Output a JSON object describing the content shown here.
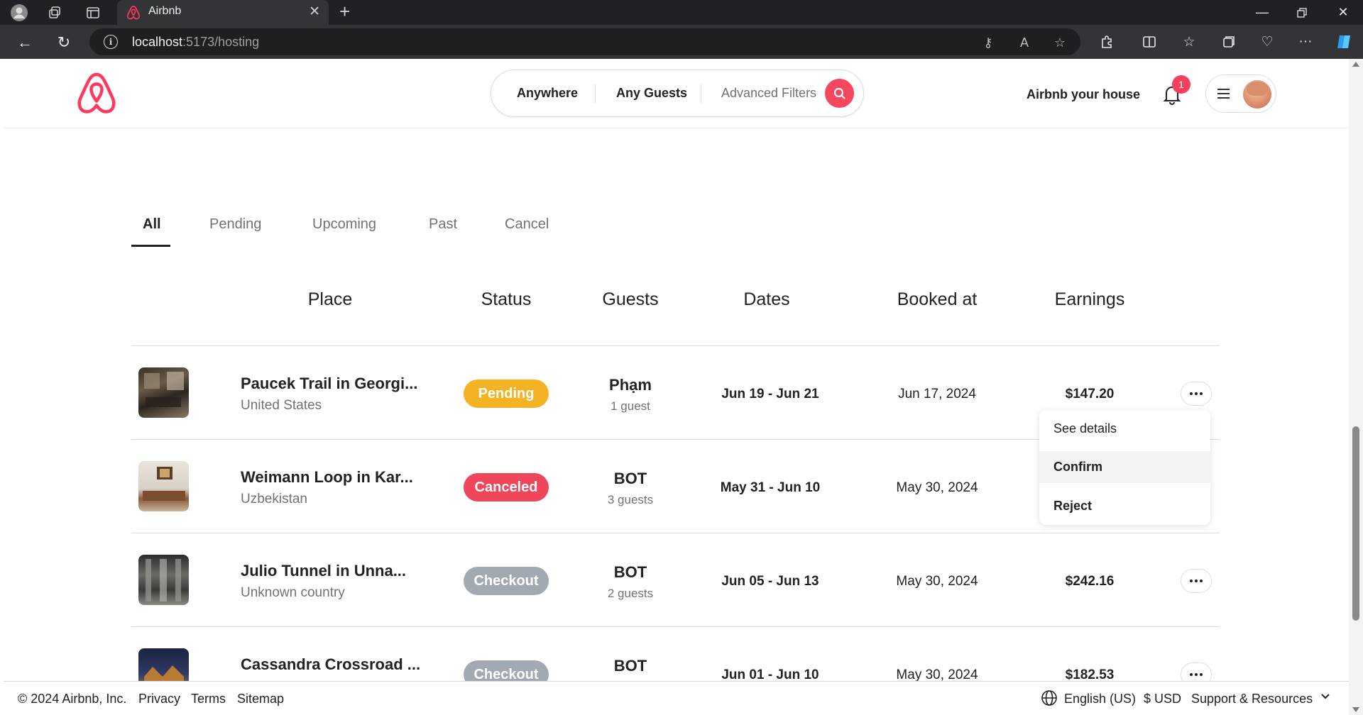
{
  "browser": {
    "tab_title": "Airbnb",
    "url_host": "localhost",
    "url_path": ":5173/hosting"
  },
  "header": {
    "search": {
      "anywhere": "Anywhere",
      "guests": "Any Guests",
      "filters": "Advanced Filters"
    },
    "host_link": "Airbnb your house",
    "notification_count": "1"
  },
  "tabs": [
    "All",
    "Pending",
    "Upcoming",
    "Past",
    "Cancel"
  ],
  "columns": [
    "Place",
    "Status",
    "Guests",
    "Dates",
    "Booked at",
    "Earnings"
  ],
  "rows": [
    {
      "title": "Paucek Trail in Georgi...",
      "country": "United States",
      "status": "Pending",
      "status_color": "#f5b324",
      "guest": "Phạm",
      "guest_count": "1 guest",
      "dates": "Jun 19 - Jun 21",
      "booked": "Jun 17, 2024",
      "earnings": "$147.20"
    },
    {
      "title": "Weimann Loop in Kar...",
      "country": "Uzbekistan",
      "status": "Canceled",
      "status_color": "#f0465c",
      "guest": "BOT",
      "guest_count": "3 guests",
      "dates": "May 31 - Jun 10",
      "booked": "May 30, 2024",
      "earnings": ""
    },
    {
      "title": "Julio Tunnel in Unna...",
      "country": "Unknown country",
      "status": "Checkout",
      "status_color": "#a3a9b3",
      "guest": "BOT",
      "guest_count": "2 guests",
      "dates": "Jun 05 - Jun 13",
      "booked": "May 30, 2024",
      "earnings": "$242.16"
    },
    {
      "title": "Cassandra Crossroad ...",
      "country": "",
      "status": "Checkout",
      "status_color": "#a3a9b3",
      "guest": "BOT",
      "guest_count": "",
      "dates": "Jun 01 - Jun 10",
      "booked": "May 30, 2024",
      "earnings": "$182.53"
    }
  ],
  "dropdown": [
    "See details",
    "Confirm",
    "Reject"
  ],
  "footer": {
    "copyright": "© 2024 Airbnb, Inc.",
    "links": [
      "Privacy",
      "Terms",
      "Sitemap"
    ],
    "language": "English (US)",
    "currency": "$ USD",
    "support": "Support & Resources"
  },
  "colors": {
    "brand": "#ff385c",
    "search_button": "#f6475f"
  }
}
